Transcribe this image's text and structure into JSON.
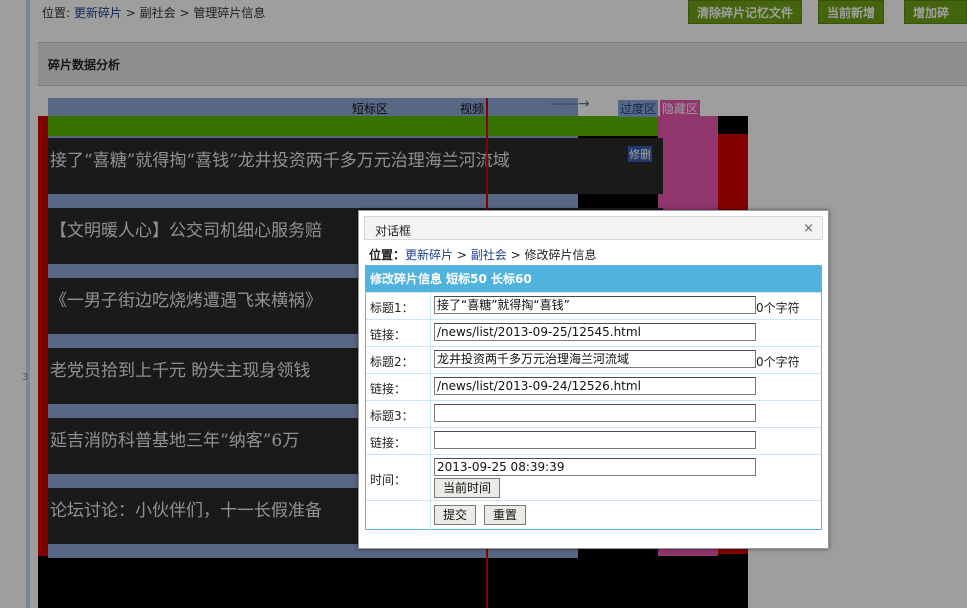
{
  "breadcrumb": {
    "prefix": "位置:",
    "link1": "更新碎片",
    "sep1": ">",
    "link2": "副社会",
    "sep2": ">",
    "current": "管理碎片信息"
  },
  "toolbar": {
    "clear_memory": "清除碎片记忆文件",
    "current_new": "当前新增",
    "add_fragment": "增加碎片"
  },
  "section_title": "碎片数据分析",
  "row_number": "3",
  "preview": {
    "label_short": "短标区",
    "label_video": "视频",
    "arrow": "——→",
    "label_transition": "过度区",
    "label_hidden": "隐藏区",
    "edit_label": "修删",
    "fragments": [
      "接了“喜糖”就得掏“喜钱”龙井投资两千多万元治理海兰河流域",
      "【文明暖人心】公交司机细心服务赔",
      "《一男子街边吃烧烤遭遇飞来横祸》",
      "老党员拾到上千元 盼失主现身领钱",
      "延吉消防科普基地三年“纳客”6万",
      "论坛讨论：小伙伴们，十一长假准备"
    ]
  },
  "dialog": {
    "title": "对话框",
    "close": "×",
    "crumb_prefix": "位置：",
    "crumb_link1": "更新碎片",
    "crumb_sep1": ">",
    "crumb_link2": "副社会",
    "crumb_sep2": ">",
    "crumb_current": "修改碎片信息",
    "form_header": "修改碎片信息 短标50 长标60",
    "title1_label": "标题1：",
    "title1_value": "接了“喜糖”就得掏“喜钱”",
    "title1_count": "0个字符",
    "link1_label": "链接：",
    "link1_value": "/news/list/2013-09-25/12545.html",
    "title2_label": "标题2：",
    "title2_value": "龙井投资两千多万元治理海兰河流域",
    "title2_count": "0个字符",
    "link2_label": "链接：",
    "link2_value": "/news/list/2013-09-24/12526.html",
    "title3_label": "标题3：",
    "title3_value": "",
    "link3_label": "链接：",
    "link3_value": "",
    "time_label": "时间：",
    "time_value": "2013-09-25 08:39:39",
    "now_button": "当前时间",
    "submit_button": "提交",
    "reset_button": "重置"
  }
}
